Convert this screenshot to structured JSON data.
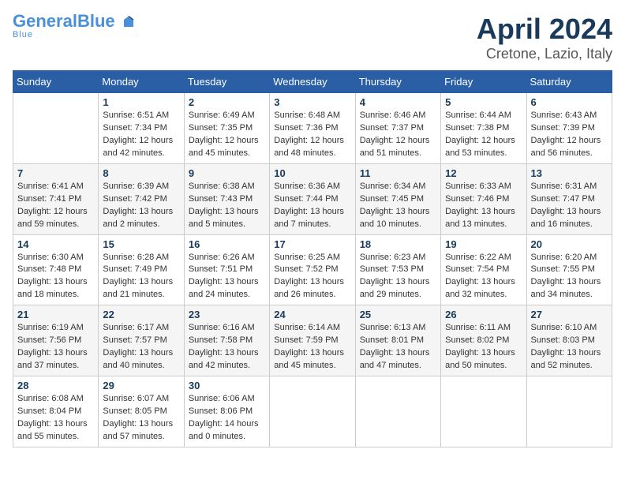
{
  "header": {
    "logo_general": "General",
    "logo_blue": "Blue",
    "title": "April 2024",
    "subtitle": "Cretone, Lazio, Italy"
  },
  "columns": [
    "Sunday",
    "Monday",
    "Tuesday",
    "Wednesday",
    "Thursday",
    "Friday",
    "Saturday"
  ],
  "weeks": [
    [
      {
        "day": "",
        "lines": []
      },
      {
        "day": "1",
        "lines": [
          "Sunrise: 6:51 AM",
          "Sunset: 7:34 PM",
          "Daylight: 12 hours",
          "and 42 minutes."
        ]
      },
      {
        "day": "2",
        "lines": [
          "Sunrise: 6:49 AM",
          "Sunset: 7:35 PM",
          "Daylight: 12 hours",
          "and 45 minutes."
        ]
      },
      {
        "day": "3",
        "lines": [
          "Sunrise: 6:48 AM",
          "Sunset: 7:36 PM",
          "Daylight: 12 hours",
          "and 48 minutes."
        ]
      },
      {
        "day": "4",
        "lines": [
          "Sunrise: 6:46 AM",
          "Sunset: 7:37 PM",
          "Daylight: 12 hours",
          "and 51 minutes."
        ]
      },
      {
        "day": "5",
        "lines": [
          "Sunrise: 6:44 AM",
          "Sunset: 7:38 PM",
          "Daylight: 12 hours",
          "and 53 minutes."
        ]
      },
      {
        "day": "6",
        "lines": [
          "Sunrise: 6:43 AM",
          "Sunset: 7:39 PM",
          "Daylight: 12 hours",
          "and 56 minutes."
        ]
      }
    ],
    [
      {
        "day": "7",
        "lines": [
          "Sunrise: 6:41 AM",
          "Sunset: 7:41 PM",
          "Daylight: 12 hours",
          "and 59 minutes."
        ]
      },
      {
        "day": "8",
        "lines": [
          "Sunrise: 6:39 AM",
          "Sunset: 7:42 PM",
          "Daylight: 13 hours",
          "and 2 minutes."
        ]
      },
      {
        "day": "9",
        "lines": [
          "Sunrise: 6:38 AM",
          "Sunset: 7:43 PM",
          "Daylight: 13 hours",
          "and 5 minutes."
        ]
      },
      {
        "day": "10",
        "lines": [
          "Sunrise: 6:36 AM",
          "Sunset: 7:44 PM",
          "Daylight: 13 hours",
          "and 7 minutes."
        ]
      },
      {
        "day": "11",
        "lines": [
          "Sunrise: 6:34 AM",
          "Sunset: 7:45 PM",
          "Daylight: 13 hours",
          "and 10 minutes."
        ]
      },
      {
        "day": "12",
        "lines": [
          "Sunrise: 6:33 AM",
          "Sunset: 7:46 PM",
          "Daylight: 13 hours",
          "and 13 minutes."
        ]
      },
      {
        "day": "13",
        "lines": [
          "Sunrise: 6:31 AM",
          "Sunset: 7:47 PM",
          "Daylight: 13 hours",
          "and 16 minutes."
        ]
      }
    ],
    [
      {
        "day": "14",
        "lines": [
          "Sunrise: 6:30 AM",
          "Sunset: 7:48 PM",
          "Daylight: 13 hours",
          "and 18 minutes."
        ]
      },
      {
        "day": "15",
        "lines": [
          "Sunrise: 6:28 AM",
          "Sunset: 7:49 PM",
          "Daylight: 13 hours",
          "and 21 minutes."
        ]
      },
      {
        "day": "16",
        "lines": [
          "Sunrise: 6:26 AM",
          "Sunset: 7:51 PM",
          "Daylight: 13 hours",
          "and 24 minutes."
        ]
      },
      {
        "day": "17",
        "lines": [
          "Sunrise: 6:25 AM",
          "Sunset: 7:52 PM",
          "Daylight: 13 hours",
          "and 26 minutes."
        ]
      },
      {
        "day": "18",
        "lines": [
          "Sunrise: 6:23 AM",
          "Sunset: 7:53 PM",
          "Daylight: 13 hours",
          "and 29 minutes."
        ]
      },
      {
        "day": "19",
        "lines": [
          "Sunrise: 6:22 AM",
          "Sunset: 7:54 PM",
          "Daylight: 13 hours",
          "and 32 minutes."
        ]
      },
      {
        "day": "20",
        "lines": [
          "Sunrise: 6:20 AM",
          "Sunset: 7:55 PM",
          "Daylight: 13 hours",
          "and 34 minutes."
        ]
      }
    ],
    [
      {
        "day": "21",
        "lines": [
          "Sunrise: 6:19 AM",
          "Sunset: 7:56 PM",
          "Daylight: 13 hours",
          "and 37 minutes."
        ]
      },
      {
        "day": "22",
        "lines": [
          "Sunrise: 6:17 AM",
          "Sunset: 7:57 PM",
          "Daylight: 13 hours",
          "and 40 minutes."
        ]
      },
      {
        "day": "23",
        "lines": [
          "Sunrise: 6:16 AM",
          "Sunset: 7:58 PM",
          "Daylight: 13 hours",
          "and 42 minutes."
        ]
      },
      {
        "day": "24",
        "lines": [
          "Sunrise: 6:14 AM",
          "Sunset: 7:59 PM",
          "Daylight: 13 hours",
          "and 45 minutes."
        ]
      },
      {
        "day": "25",
        "lines": [
          "Sunrise: 6:13 AM",
          "Sunset: 8:01 PM",
          "Daylight: 13 hours",
          "and 47 minutes."
        ]
      },
      {
        "day": "26",
        "lines": [
          "Sunrise: 6:11 AM",
          "Sunset: 8:02 PM",
          "Daylight: 13 hours",
          "and 50 minutes."
        ]
      },
      {
        "day": "27",
        "lines": [
          "Sunrise: 6:10 AM",
          "Sunset: 8:03 PM",
          "Daylight: 13 hours",
          "and 52 minutes."
        ]
      }
    ],
    [
      {
        "day": "28",
        "lines": [
          "Sunrise: 6:08 AM",
          "Sunset: 8:04 PM",
          "Daylight: 13 hours",
          "and 55 minutes."
        ]
      },
      {
        "day": "29",
        "lines": [
          "Sunrise: 6:07 AM",
          "Sunset: 8:05 PM",
          "Daylight: 13 hours",
          "and 57 minutes."
        ]
      },
      {
        "day": "30",
        "lines": [
          "Sunrise: 6:06 AM",
          "Sunset: 8:06 PM",
          "Daylight: 14 hours",
          "and 0 minutes."
        ]
      },
      {
        "day": "",
        "lines": []
      },
      {
        "day": "",
        "lines": []
      },
      {
        "day": "",
        "lines": []
      },
      {
        "day": "",
        "lines": []
      }
    ]
  ]
}
